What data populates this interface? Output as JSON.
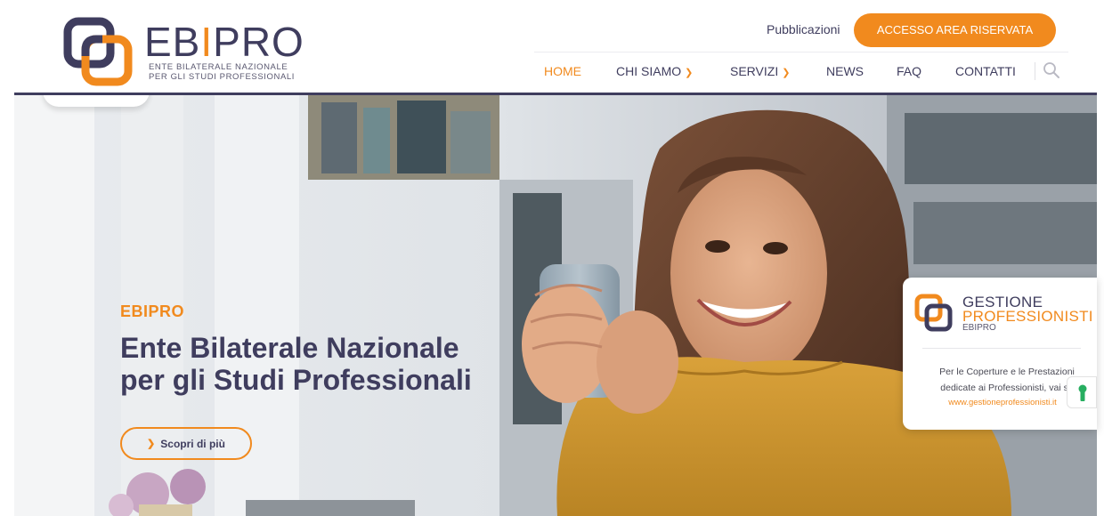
{
  "header": {
    "logo": {
      "word_part1": "EB",
      "word_part2": "I",
      "word_part3": "PRO",
      "subtitle_line1": "ENTE BILATERALE NAZIONALE",
      "subtitle_line2": "PER GLI STUDI PROFESSIONALI"
    },
    "pubblicazioni": "Pubblicazioni",
    "cta": "ACCESSO AREA RISERVATA",
    "nav": [
      {
        "label": "HOME",
        "active": true
      },
      {
        "label": "CHI SIAMO",
        "dropdown": true
      },
      {
        "label": "SERVIZI",
        "dropdown": true
      },
      {
        "label": "NEWS"
      },
      {
        "label": "FAQ"
      },
      {
        "label": "CONTATTI"
      }
    ],
    "icons": {
      "search": "search-icon"
    }
  },
  "hero": {
    "eyebrow": "EBIPRO",
    "headline_line1": "Ente Bilaterale Nazionale",
    "headline_line2": "per gli Studi Professionali",
    "button": "Scopri di più"
  },
  "side_card": {
    "title1": "GESTIONE",
    "title2": "PROFESSIONISTI",
    "title3": "EBIPRO",
    "text": "Per le Coperture e le Prestazioni dedicate ai Professionisti, vai su",
    "link": "www.gestioneprofessionisti.it"
  },
  "colors": {
    "brand_orange": "#f18a1e",
    "brand_navy": "#3f3d5e",
    "green_accent": "#27ae60"
  }
}
